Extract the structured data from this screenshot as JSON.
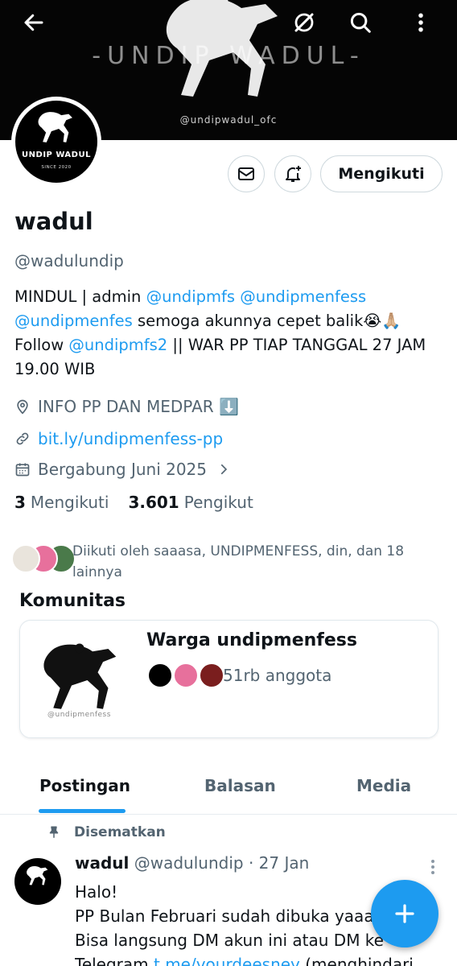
{
  "banner": {
    "title": "-UNDIP WADUL-",
    "handle": "@undipwadul_ofc"
  },
  "toolbar": {
    "back_icon": "arrow-left-icon",
    "grok_icon": "grok-icon",
    "search_icon": "search-icon",
    "more_icon": "more-vertical-icon"
  },
  "avatar": {
    "name": "UNDIP WADUL",
    "since": "SINCE 2020"
  },
  "actions": {
    "follow_label": "Mengikuti"
  },
  "profile": {
    "display_name": "wadul",
    "handle": "@wadulundip",
    "bio": {
      "t1": "MINDUL | admin ",
      "m1": "@undipmfs",
      "m2": "@undipmenfess",
      "m3": "@undipmenfes",
      "t2": " semoga akunnya cepet balik😭🙏🏼",
      "t3": "Follow ",
      "m4": "@undipmfs2",
      "t4": " || WAR PP TIAP TANGGAL 27 JAM 19.00 WIB"
    },
    "location": "INFO PP DAN MEDPAR ⬇️",
    "link": "bit.ly/undipmenfess-pp",
    "joined": "Bergabung Juni 2025",
    "following_count": "3",
    "following_label": "Mengikuti",
    "followers_count": "3.601",
    "followers_label": "Pengikut"
  },
  "followed_by": "Diikuti oleh saaasa, UNDIPMENFESS, din, dan 18 lainnya",
  "communities": {
    "title": "Komunitas",
    "watermark": "@undipmenfess",
    "name": "Warga undipmenfess",
    "members": "51rb anggota"
  },
  "tabs": [
    "Postingan",
    "Balasan",
    "Media"
  ],
  "post": {
    "pinned_label": "Disematkan",
    "name": "wadul",
    "handle": "@wadulundip",
    "time": "· 27 Jan",
    "line1": "Halo!",
    "line2": "PP Bulan Februari sudah dibuka yaaa",
    "line3": "Bisa langsung DM akun ini atau DM ke",
    "line4_text": "Telegram ",
    "line4_link": "t.me/yourdeesney",
    "line4_tail": " (menghindari"
  },
  "colors": {
    "accent": "#1d9bf0",
    "text": "#0f1419",
    "muted": "#536471"
  }
}
